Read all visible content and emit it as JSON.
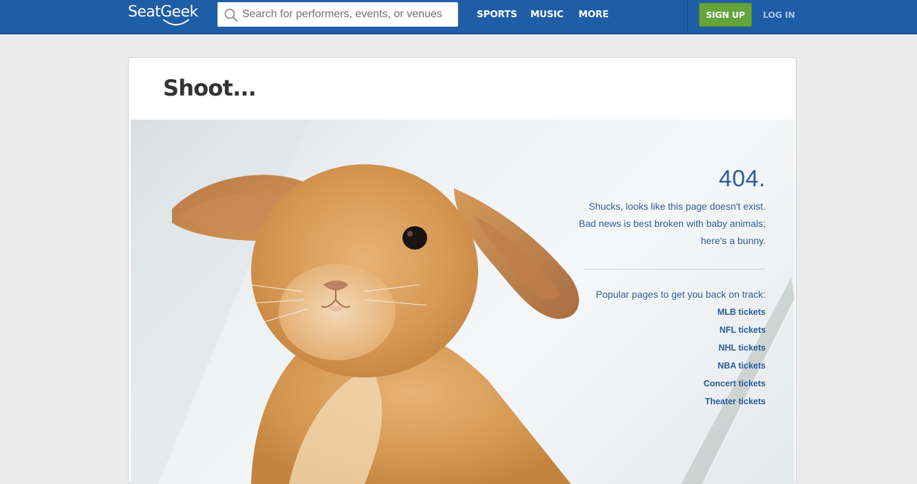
{
  "header": {
    "logo_text": "SeatGeek",
    "search": {
      "placeholder": "Search for performers, events, or venues",
      "value": ""
    },
    "nav": [
      "SPORTS",
      "MUSIC",
      "MORE"
    ],
    "signup_label": "SIGN UP",
    "login_label": "LOG IN"
  },
  "colors": {
    "header_bg": "#1f5da6",
    "signup_bg": "#63a53a",
    "link_blue": "#2b5d98",
    "page_bg": "#ebebeb"
  },
  "page": {
    "title": "Shoot...",
    "error_code": "404.",
    "message_lines": [
      "Shucks, looks like this page doesn't exist.",
      "Bad news is best broken with baby animals;",
      "here's a bunny."
    ],
    "popular_heading": "Popular pages to get you back on track:",
    "popular_links": [
      "MLB tickets",
      "NFL tickets",
      "NHL tickets",
      "NBA tickets",
      "Concert tickets",
      "Theater tickets"
    ]
  }
}
